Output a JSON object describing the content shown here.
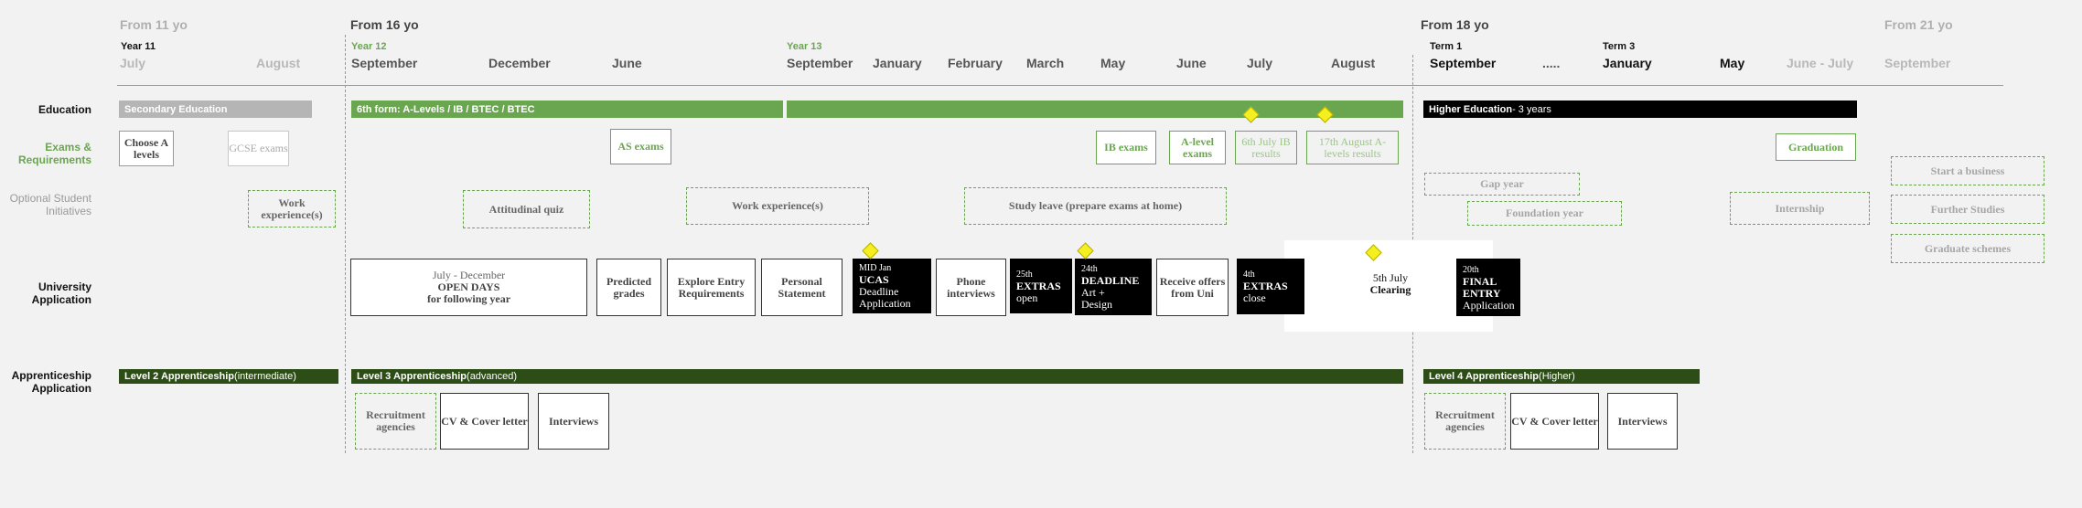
{
  "colors": {
    "green": "#6aa64f",
    "dark_green": "#2d4d16",
    "grey_bar": "#b5b5b5",
    "black": "#000000",
    "diamond": "#f5ef1f"
  },
  "phases": {
    "p11": "From 11 yo",
    "p16": "From 16 yo",
    "p18": "From 18 yo",
    "p21": "From 21 yo"
  },
  "years": {
    "y11": "Year 11",
    "y12": "Year 12",
    "y13": "Year 13",
    "t1": "Term 1",
    "t3": "Term 3"
  },
  "months": {
    "m1": "July",
    "m2": "August",
    "m3": "September",
    "m4": "December",
    "m5": "June",
    "m6": "September",
    "m7": "January",
    "m8": "February",
    "m9": "March",
    "m10": "May",
    "m11": "June",
    "m12": "July",
    "m13": "August",
    "m14": "September",
    "m15": ".....",
    "m16": "January",
    "m17": "May",
    "m18": "June - July",
    "m19": "September"
  },
  "rows": {
    "education": "Education",
    "exams": "Exams & Requirements",
    "optional": "Optional Student Initiatives",
    "university": "University Application",
    "apprenticeship": "Apprenticeship Application"
  },
  "education": {
    "secondary": "Secondary Education",
    "sixth_form": "6th form: A-Levels / IB / BTEC / BTEC",
    "higher": "Higher Education",
    "higher_suffix": " - 3 years"
  },
  "exams": {
    "choose": "Choose A levels",
    "gcse": "GCSE exams",
    "as": "AS exams",
    "ib": "IB exams",
    "alevel": "A-level exams",
    "ib_results": "6th July IB results",
    "a_results": "17th August A-levels results",
    "graduation": "Graduation"
  },
  "optional": {
    "work1": "Work experience(s)",
    "quiz": "Attitudinal quiz",
    "work2": "Work experience(s)",
    "study": "Study leave (prepare exams at home)",
    "gap": "Gap year",
    "foundation": "Foundation year",
    "internship": "Internship",
    "business": "Start a business",
    "further": "Further Studies",
    "graduate": "Graduate schemes"
  },
  "university": {
    "open_days_top": "July - December",
    "open_days_main": "OPEN DAYS",
    "open_days_sub": "for following year",
    "predicted": "Predicted grades",
    "explore": "Explore Entry Requirements",
    "personal": "Personal Statement",
    "ucas_date": "MID Jan",
    "ucas_title": "UCAS",
    "ucas_line1": "Deadline",
    "ucas_line2": "Application",
    "phone": "Phone interviews",
    "extras_open_date": "25th",
    "extras_open_title": "EXTRAS",
    "extras_open_sub": "open",
    "deadline_date": "24th",
    "deadline_title": "DEADLINE",
    "deadline_line1": "Art +",
    "deadline_line2": "Design",
    "receive": "Receive offers from Uni",
    "extras_close_date": "4th",
    "extras_close_title": "EXTRAS",
    "extras_close_sub": "close",
    "clearing_date": "5th July",
    "clearing_title": "Clearing",
    "final_date": "20th",
    "final_title": "FINAL ENTRY",
    "final_sub": "Application"
  },
  "apprenticeship": {
    "l2": "Level 2 Apprenticeship",
    "l2_suffix": " (intermediate)",
    "l3": "Level 3 Apprenticeship",
    "l3_suffix": " (advanced)",
    "l4": "Level 4 Apprenticeship",
    "l4_suffix": " (Higher)",
    "recruit1": "Recruitment agencies",
    "cv1": "CV & Cover letter",
    "interviews1": "Interviews",
    "recruit2": "Recruitment agencies",
    "cv2": "CV & Cover letter",
    "interviews2": "Interviews"
  }
}
